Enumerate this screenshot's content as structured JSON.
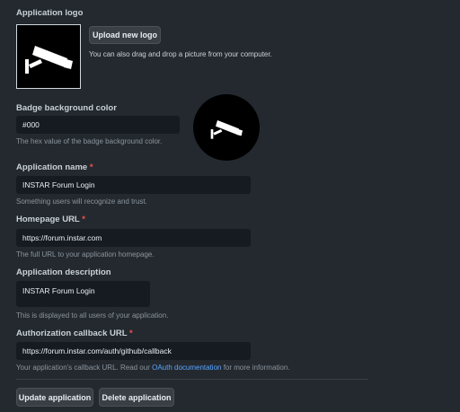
{
  "logo": {
    "section_label": "Application logo",
    "upload_button": "Upload new logo",
    "drag_hint": "You can also drag and drop a picture from your computer.",
    "icon": "security-camera-icon"
  },
  "badge": {
    "label": "Badge background color",
    "value": "#000",
    "hint": "The hex value of the badge background color.",
    "color": "#000000"
  },
  "app_name": {
    "label": "Application name",
    "required_mark": "*",
    "value": "INSTAR Forum Login",
    "hint": "Something users will recognize and trust."
  },
  "homepage": {
    "label": "Homepage URL",
    "required_mark": "*",
    "value": "https://forum.instar.com",
    "hint": "The full URL to your application homepage."
  },
  "description": {
    "label": "Application description",
    "value": "INSTAR Forum Login",
    "hint": "This is displayed to all users of your application."
  },
  "callback": {
    "label": "Authorization callback URL",
    "required_mark": "*",
    "value": "https://forum.instar.com/auth/github/callback",
    "hint_before": "Your application's callback URL. Read our ",
    "hint_link": "OAuth documentation",
    "hint_after": " for more information."
  },
  "actions": {
    "update": "Update application",
    "delete": "Delete application"
  },
  "colors": {
    "background": "#24292f",
    "field": "#161b22",
    "link": "#58a6ff",
    "required": "#f85149"
  }
}
